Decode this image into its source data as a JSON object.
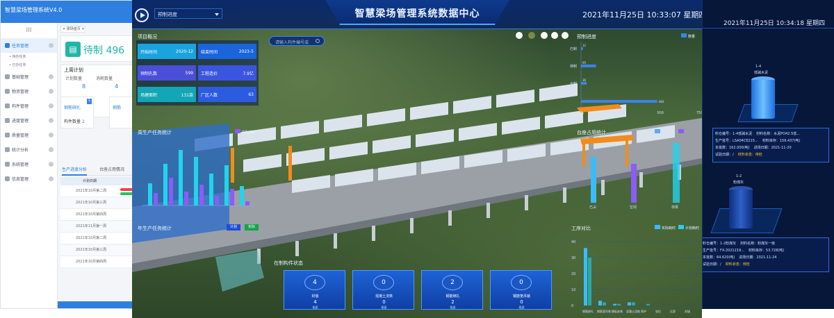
{
  "admin": {
    "app_title": "智慧梁场管理系统V4.0",
    "hamburger": "III",
    "menu": [
      {
        "label": "任务管理",
        "active": true
      },
      {
        "label": "基础管理"
      },
      {
        "label": "物资管理"
      },
      {
        "label": "构件管理"
      },
      {
        "label": "进度管理"
      },
      {
        "label": "质量管理"
      },
      {
        "label": "统计分析"
      },
      {
        "label": "系统管理"
      },
      {
        "label": "信息管理"
      }
    ],
    "submenu": [
      "• 待办任务",
      "• 已办任务"
    ],
    "tab": "✕ 梁场首页 ✕",
    "pending_label": "待制 496",
    "plan_title": "上周计划",
    "plan_labels": [
      "计划数量",
      "消耗数量"
    ],
    "plan_values": [
      "8",
      "4"
    ],
    "card_names": [
      "钢筋绑扎",
      "钢筋"
    ],
    "card_count_label": "构件数量",
    "card_count_value": "2",
    "tabs": [
      "生产进度分析",
      "台座占用情况"
    ],
    "table_header": "计划日期",
    "table_rows": [
      "2021年10月第二周",
      "2021年10月第三周",
      "2021年10月第四周",
      "2021年11月第一周",
      "2021年10月第二周",
      "2021年10月第三周",
      "2021年10月第四周"
    ]
  },
  "dashboard": {
    "title": "智慧梁场管理系统数据中心",
    "select_value": "预制进度",
    "datetime": "2021年11月25日  10:33:07  星期四",
    "search_placeholder": "请输入构件编号或",
    "project_title": "项目概况",
    "kpis": [
      {
        "label": "开始时间",
        "value": "2020-12",
        "color": "#1ba3e0"
      },
      {
        "label": "结束时间",
        "value": "2023-5",
        "color": "#1a64dc"
      },
      {
        "label": "预制孔数",
        "value": "599",
        "color": "#4a4ed8"
      },
      {
        "label": "工程造价",
        "value": "7.9亿",
        "color": "#3a55e0"
      },
      {
        "label": "场建面积",
        "value": "131亩",
        "color": "#12a6b7"
      },
      {
        "label": "厂区人数",
        "value": "63",
        "color": "#2d5be0"
      }
    ],
    "prod_progress_title": "预制进度",
    "prod_progress_legend": "数量",
    "prod_progress_axis": [
      "0%",
      "250",
      "500",
      "750"
    ],
    "prod_progress_labels": [
      "已制",
      "待制",
      "合制"
    ],
    "prod_progress_values": [
      "12",
      "95",
      "36"
    ],
    "total_label": "484",
    "week_stats_title": "周生产任务统计",
    "week_stats_legend": "实际消耗",
    "pedestal_title": "台座占用统计",
    "pedestal_labels": [
      "已占",
      "空闲",
      "存梁"
    ],
    "year_stats_title": "年生产任务统计",
    "year_legend": [
      "计划",
      "实际"
    ],
    "component_status_title": "在制构件状态",
    "stats": [
      {
        "circle": "4",
        "label": "封装",
        "value": "4",
        "unit": "榀梁"
      },
      {
        "circle": "0",
        "label": "混凝土浇筑",
        "value": "0",
        "unit": "榀梁"
      },
      {
        "circle": "2",
        "label": "钢筋绑扎",
        "value": "2",
        "unit": "榀梁"
      },
      {
        "circle": "0",
        "label": "钢筋笼吊装",
        "value": "0",
        "unit": "榀梁"
      }
    ],
    "work_title": "工序对比",
    "work_legend": [
      "实际耗时",
      "计划耗时"
    ],
    "work_y_ticks": [
      "40",
      "30",
      "20",
      "10",
      "0"
    ],
    "work_categories": [
      "钢筋绑扎",
      "钢筋笼吊装",
      "模板安装",
      "混凝土浇筑",
      "养护",
      "张拉",
      "压浆",
      "封锚"
    ]
  },
  "tablet": {
    "datetime": "2021年11月25日  10:34:18  星期四",
    "silo1_label": "1-4",
    "silo1_name": "低碱水泥",
    "silo2_label": "1-2",
    "silo2_name": "粉煤灰",
    "info1": [
      [
        "料仓编号：1-4低碱水泥",
        "材料名称：水泥PO42.5低..."
      ],
      [
        "生产批号：LSA04CE215...",
        "材料库存：159.437(吨)"
      ],
      [
        "本批数：162.000(吨)",
        "进场日期：2021-11-20"
      ],
      [
        "试验日期：/",
        "材料状态：待检"
      ]
    ],
    "info2": [
      [
        "料仓编号：1-2粉煤灰",
        "材料名称：粉煤灰一级"
      ],
      [
        "生产批号：FX-2021219...",
        "材料库存：53.728(吨)"
      ],
      [
        "本批数：64.620(吨)",
        "进场日期：2021-11-24"
      ],
      [
        "试验日期：/",
        "材料状态：待检"
      ]
    ]
  },
  "chart_data": [
    {
      "type": "bar",
      "title": "预制进度",
      "categories": [
        "已制",
        "待制",
        "合制",
        "总计"
      ],
      "values": [
        12,
        95,
        36,
        484
      ],
      "xlim": [
        0,
        750
      ],
      "legend": "top-right"
    },
    {
      "type": "bar",
      "title": "工序对比",
      "categories": [
        "钢筋绑扎",
        "钢筋笼吊装",
        "模板安装",
        "混凝土浇筑",
        "养护",
        "张拉",
        "压浆",
        "封锚"
      ],
      "series": [
        {
          "name": "实际耗时",
          "values": [
            36,
            3,
            1,
            2,
            0,
            0,
            0,
            0
          ]
        },
        {
          "name": "计划耗时",
          "values": [
            30,
            2,
            1,
            2,
            1,
            0,
            0,
            0
          ]
        }
      ],
      "ylim": [
        0,
        40
      ]
    },
    {
      "type": "bar",
      "title": "周生产任务统计",
      "series": [
        {
          "name": "计划",
          "values": [
            32,
            60,
            80,
            70,
            46,
            58,
            28
          ]
        },
        {
          "name": "实际消耗",
          "values": [
            18,
            40,
            20,
            30,
            14,
            24,
            6
          ]
        }
      ]
    }
  ]
}
